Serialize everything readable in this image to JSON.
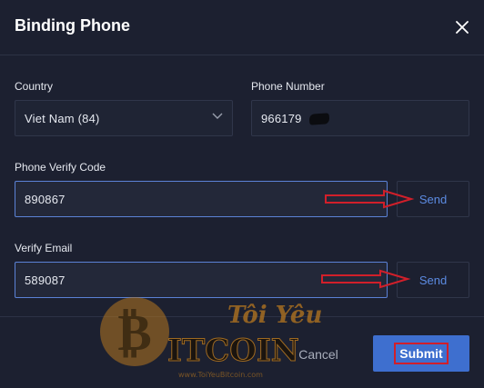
{
  "dialog": {
    "title": "Binding Phone",
    "close_icon": "close-icon"
  },
  "form": {
    "country_label": "Country",
    "country_value": "Viet Nam (84)",
    "phone_label": "Phone Number",
    "phone_value": "966179",
    "phone_verify_label": "Phone Verify Code",
    "phone_verify_value": "890867",
    "phone_send_label": "Send",
    "verify_email_label": "Verify Email",
    "verify_email_value": "589087",
    "email_send_label": "Send"
  },
  "footer": {
    "cancel_label": "Cancel",
    "submit_label": "Submit"
  },
  "watermark": {
    "line1": "Tôi Yêu",
    "line2": "ITCOIN",
    "url": "www.ToiYeuBitcoin.com"
  },
  "colors": {
    "background": "#1c2030",
    "accent": "#3e6fcf",
    "link": "#5c8be2",
    "annotation_red": "#d11f2a"
  }
}
